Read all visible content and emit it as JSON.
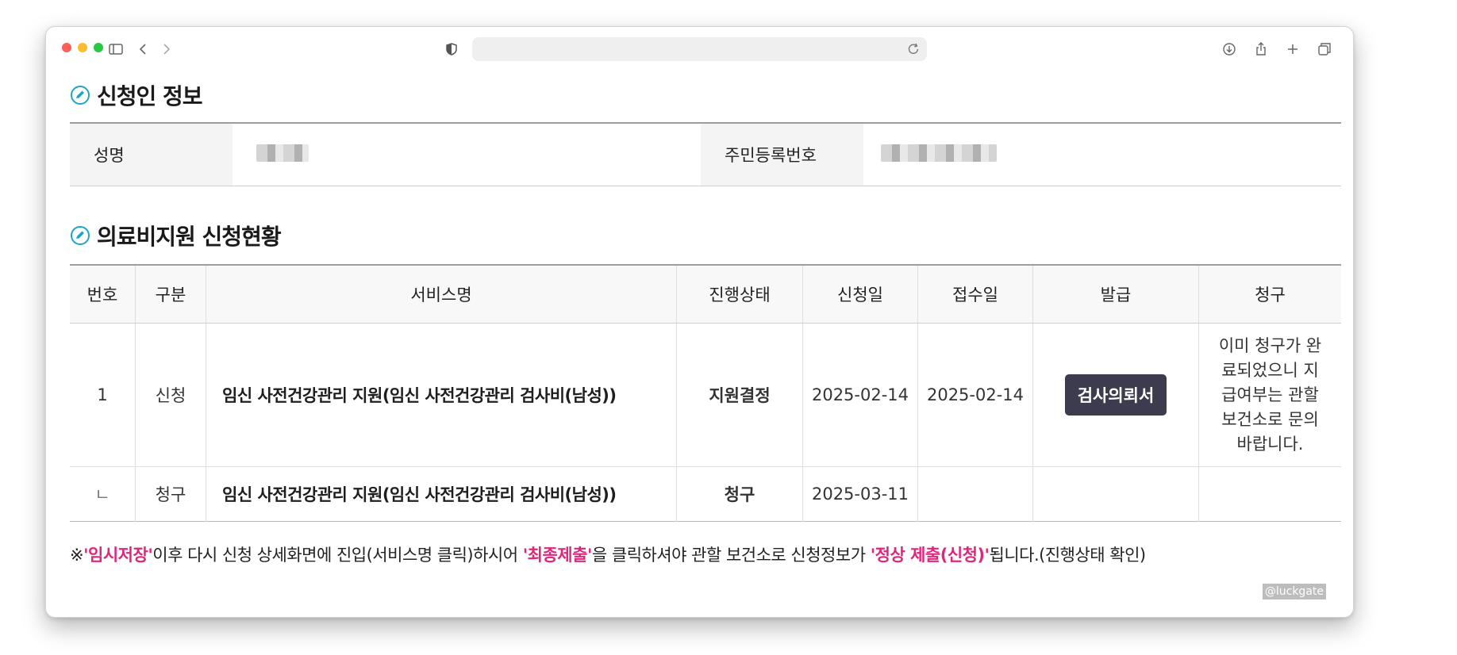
{
  "section1": {
    "title": "신청인 정보"
  },
  "applicant": {
    "name_label": "성명",
    "rrn_label": "주민등록번호"
  },
  "section2": {
    "title": "의료비지원 신청현황"
  },
  "table": {
    "headers": [
      "번호",
      "구분",
      "서비스명",
      "진행상태",
      "신청일",
      "접수일",
      "발급",
      "청구"
    ],
    "rows": [
      {
        "no": "1",
        "type": "신청",
        "service": "임신 사전건강관리 지원(임신 사전건강관리 검사비(남성))",
        "status": "지원결정",
        "applied": "2025-02-14",
        "received": "2025-02-14",
        "issue_button": "검사의뢰서",
        "claim_note": "이미 청구가 완료되었으니 지급여부는 관할보건소로 문의바랍니다."
      },
      {
        "no": "ㄴ",
        "type": "청구",
        "service": "임신 사전건강관리 지원(임신 사전건강관리 검사비(남성))",
        "status": "청구",
        "applied": "2025-03-11",
        "received": "",
        "issue_button": "",
        "claim_note": ""
      }
    ]
  },
  "notice": {
    "prefix": "※",
    "part1_highlight": "'임시저장'",
    "part2": "이후 다시 신청 상세화면에 진입(서비스명 클릭)하시어 ",
    "part3_highlight": "'최종제출'",
    "part4": "을 클릭하셔야 관할 보건소로 신청정보가 ",
    "part5_highlight": "'정상 제출(신청)'",
    "part6": "됩니다.(진행상태 확인)"
  },
  "watermark": "@luckgate",
  "colors": {
    "accent_pink": "#e0267a",
    "icon_teal": "#1aa7c7",
    "button_dark": "#3c3c4e"
  },
  "icons": [
    "sidebar-icon",
    "back-chevron-icon",
    "forward-chevron-icon",
    "privacy-shield-icon",
    "reload-icon",
    "download-icon",
    "share-icon",
    "new-tab-plus-icon",
    "tabs-overview-icon",
    "edit-circle-icon"
  ]
}
